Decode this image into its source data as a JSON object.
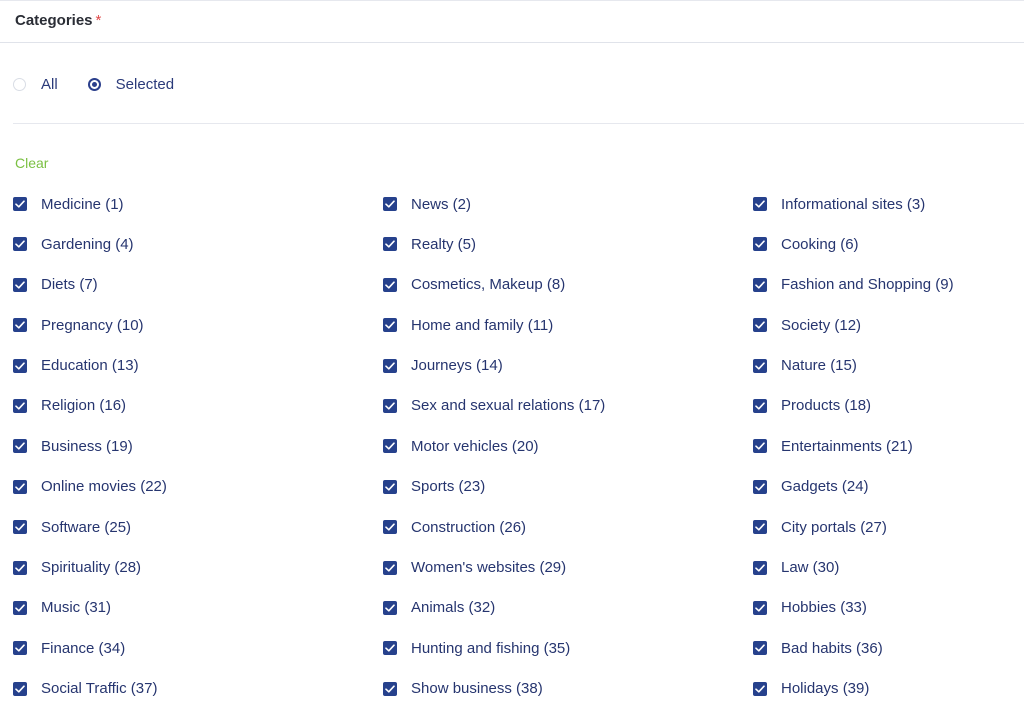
{
  "header": {
    "title": "Categories",
    "required_mark": "*"
  },
  "scope": {
    "options": [
      {
        "label": "All",
        "selected": false
      },
      {
        "label": "Selected",
        "selected": true
      }
    ]
  },
  "clear_label": "Clear",
  "categories": [
    {
      "label": "Medicine (1)",
      "checked": true
    },
    {
      "label": "News (2)",
      "checked": true
    },
    {
      "label": "Informational sites (3)",
      "checked": true
    },
    {
      "label": "Gardening (4)",
      "checked": true
    },
    {
      "label": "Realty (5)",
      "checked": true
    },
    {
      "label": "Cooking (6)",
      "checked": true
    },
    {
      "label": "Diets (7)",
      "checked": true
    },
    {
      "label": "Cosmetics, Makeup (8)",
      "checked": true
    },
    {
      "label": "Fashion and Shopping (9)",
      "checked": true
    },
    {
      "label": "Pregnancy (10)",
      "checked": true
    },
    {
      "label": "Home and family (11)",
      "checked": true
    },
    {
      "label": "Society (12)",
      "checked": true
    },
    {
      "label": "Education (13)",
      "checked": true
    },
    {
      "label": "Journeys (14)",
      "checked": true
    },
    {
      "label": "Nature (15)",
      "checked": true
    },
    {
      "label": "Religion (16)",
      "checked": true
    },
    {
      "label": "Sex and sexual relations (17)",
      "checked": true
    },
    {
      "label": "Products (18)",
      "checked": true
    },
    {
      "label": "Business (19)",
      "checked": true
    },
    {
      "label": "Motor vehicles (20)",
      "checked": true
    },
    {
      "label": "Entertainments (21)",
      "checked": true
    },
    {
      "label": "Online movies (22)",
      "checked": true
    },
    {
      "label": "Sports (23)",
      "checked": true
    },
    {
      "label": "Gadgets (24)",
      "checked": true
    },
    {
      "label": "Software (25)",
      "checked": true
    },
    {
      "label": "Construction (26)",
      "checked": true
    },
    {
      "label": "City portals (27)",
      "checked": true
    },
    {
      "label": "Spirituality (28)",
      "checked": true
    },
    {
      "label": "Women's websites (29)",
      "checked": true
    },
    {
      "label": "Law (30)",
      "checked": true
    },
    {
      "label": "Music (31)",
      "checked": true
    },
    {
      "label": "Animals (32)",
      "checked": true
    },
    {
      "label": "Hobbies (33)",
      "checked": true
    },
    {
      "label": "Finance (34)",
      "checked": true
    },
    {
      "label": "Hunting and fishing (35)",
      "checked": true
    },
    {
      "label": "Bad habits (36)",
      "checked": true
    },
    {
      "label": "Social Traffic (37)",
      "checked": true
    },
    {
      "label": "Show business (38)",
      "checked": true
    },
    {
      "label": "Holidays (39)",
      "checked": true
    }
  ],
  "colors": {
    "accent": "#26418c",
    "clear_link": "#7bc043",
    "required": "#e04848"
  }
}
